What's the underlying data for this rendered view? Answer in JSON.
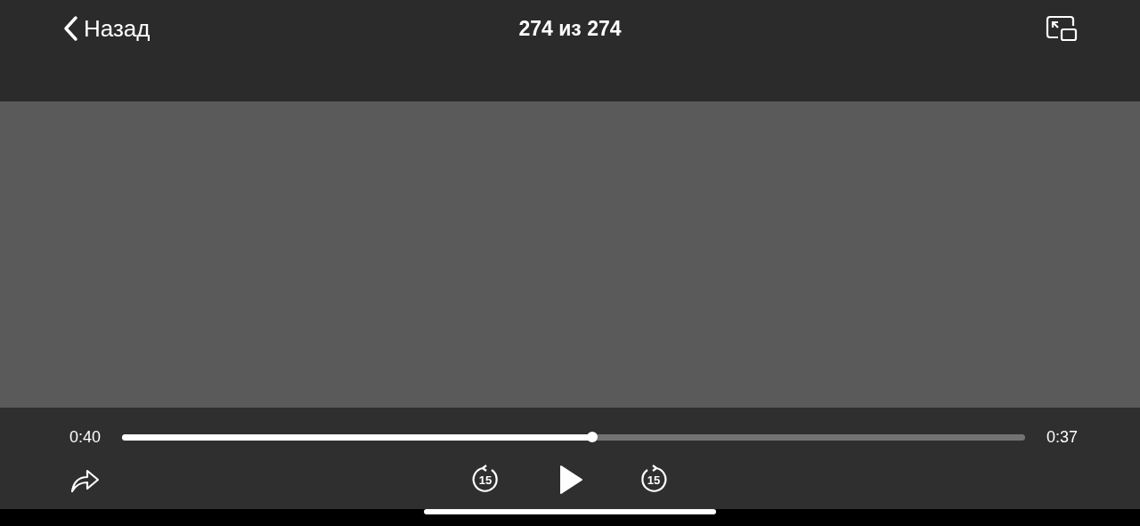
{
  "top_bar": {
    "back_label": "Назад",
    "title": "274 из 274"
  },
  "playback": {
    "elapsed": "0:40",
    "remaining": "0:37",
    "level": 0.521
  },
  "controls": {
    "skip_back_label": "15",
    "skip_forward_label": "15",
    "playing": false
  }
}
